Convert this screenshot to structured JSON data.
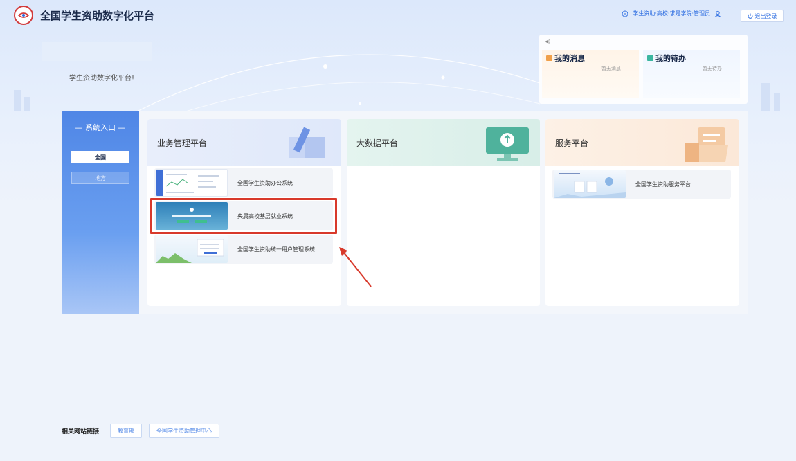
{
  "header": {
    "brand": "全国学生资助数字化平台",
    "user_info": "学生资助·高校·求是学院·管理员",
    "logout_label": "退出登录"
  },
  "welcome_text": "学生资助数字化平台!",
  "messages": {
    "my_messages_title": "我的消息",
    "my_messages_empty": "暂无消息",
    "my_todos_title": "我的待办",
    "my_todos_empty": "暂无待办"
  },
  "sidebar": {
    "title": "— 系统入口 —",
    "items": [
      {
        "label": "全国",
        "active": true
      },
      {
        "label": "地方",
        "active": false
      }
    ]
  },
  "cards": [
    {
      "title": "业务管理平台",
      "systems": [
        {
          "label": "全国学生资助办公系统"
        },
        {
          "label": "央属高校基层就业系统"
        },
        {
          "label": "全国学生资助统一用户管理系统"
        }
      ]
    },
    {
      "title": "大数据平台",
      "systems": []
    },
    {
      "title": "服务平台",
      "systems": [
        {
          "label": "全国学生资助服务平台"
        }
      ]
    }
  ],
  "footer": {
    "label": "相关网站链接",
    "links": [
      "教育部",
      "全国学生资助管理中心"
    ]
  },
  "colors": {
    "primary": "#2a6be0",
    "highlight": "#d8392b",
    "sidebar": "#4f86e6"
  }
}
